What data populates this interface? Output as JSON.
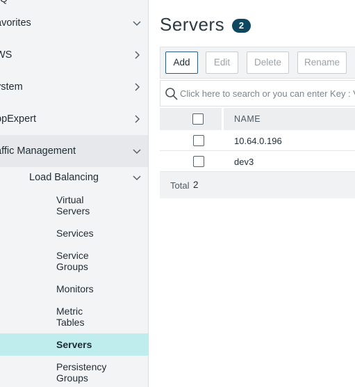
{
  "sidebar": {
    "top_fragment": "Q",
    "sections": {
      "favorites": "avorites",
      "aws": "WS",
      "system": "ystem",
      "appexpert": "ppExpert",
      "traffic_management": "affic Management",
      "load_balancing": "Load Balancing"
    },
    "leaves": {
      "virtual_servers": "Virtual\nServers",
      "services": "Services",
      "service_groups": "Service\nGroups",
      "monitors": "Monitors",
      "metric_tables": "Metric\nTables",
      "servers": "Servers",
      "persistency_groups": "Persistency\nGroups"
    },
    "selected": "servers",
    "selected_color": "#bfecec"
  },
  "main": {
    "title": "Servers",
    "count_badge": "2",
    "badge_color": "#0e4760",
    "toolbar": {
      "add": "Add",
      "edit": "Edit",
      "delete": "Delete",
      "rename": "Rename"
    },
    "search": {
      "placeholder": "Click here to search or you can enter Key : Val"
    },
    "table": {
      "column_name": "NAME",
      "rows": [
        {
          "name": "10.64.0.196"
        },
        {
          "name": "dev3"
        }
      ],
      "total_label": "Total",
      "total_value": "2"
    }
  }
}
